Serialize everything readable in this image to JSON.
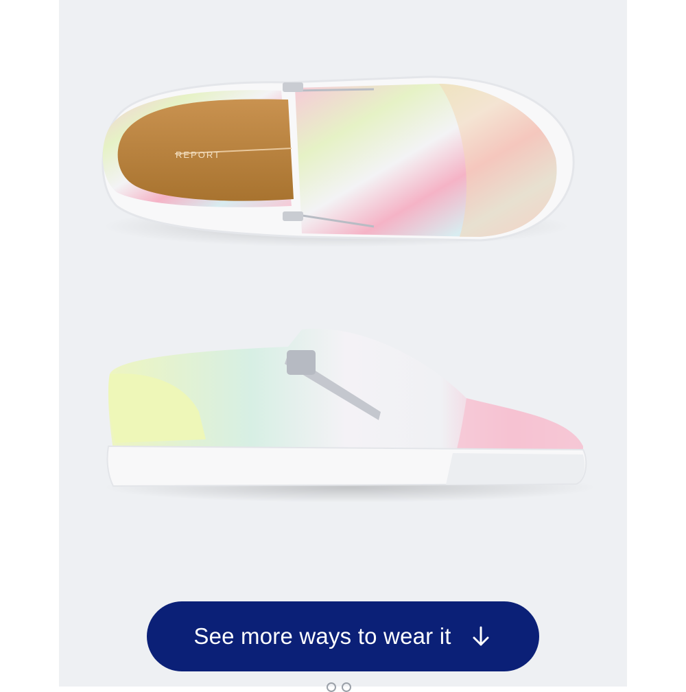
{
  "product": {
    "image_name": "tie-dye slip-on sneaker",
    "insole_brand": "REPORT"
  },
  "cta": {
    "label": "See more ways to wear it",
    "icon": "arrow-down-icon",
    "background": "#0b2077",
    "text_color": "#ffffff"
  },
  "carousel": {
    "slides": 2,
    "active_index": 0
  }
}
